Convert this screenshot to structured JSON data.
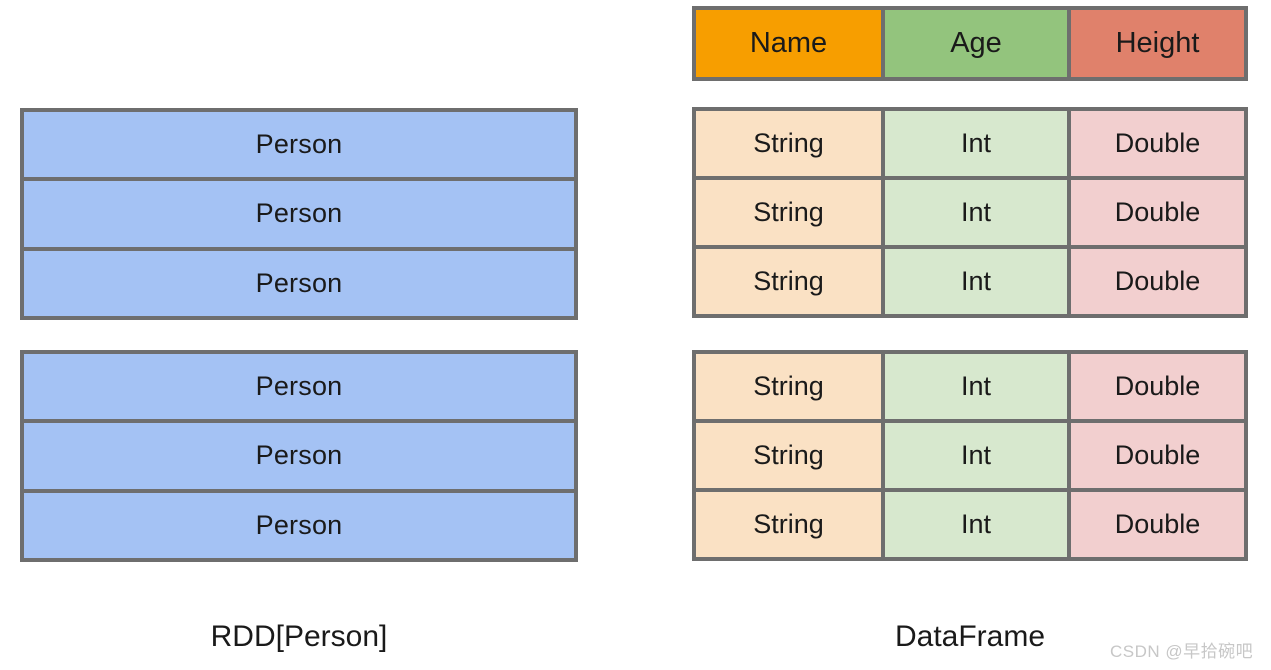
{
  "palette": {
    "border": "#6e6e6e",
    "rdd_row": "#a4c2f4",
    "header_name": "#f79e00",
    "header_age": "#93c47d",
    "header_height": "#e0816b",
    "cell_string": "#fae1c4",
    "cell_int": "#d7e8ce",
    "cell_double": "#f2cfcf",
    "background": "#ffffff",
    "watermark": "#c7c7c7"
  },
  "left": {
    "caption": "RDD[Person]",
    "partitions": [
      {
        "rows": [
          "Person",
          "Person",
          "Person"
        ]
      },
      {
        "rows": [
          "Person",
          "Person",
          "Person"
        ]
      }
    ]
  },
  "right": {
    "caption": "DataFrame",
    "header": [
      "Name",
      "Age",
      "Height"
    ],
    "partitions": [
      {
        "rows": [
          [
            "String",
            "Int",
            "Double"
          ],
          [
            "String",
            "Int",
            "Double"
          ],
          [
            "String",
            "Int",
            "Double"
          ]
        ]
      },
      {
        "rows": [
          [
            "String",
            "Int",
            "Double"
          ],
          [
            "String",
            "Int",
            "Double"
          ],
          [
            "String",
            "Int",
            "Double"
          ]
        ]
      }
    ]
  },
  "watermark": "CSDN @早拾碗吧"
}
